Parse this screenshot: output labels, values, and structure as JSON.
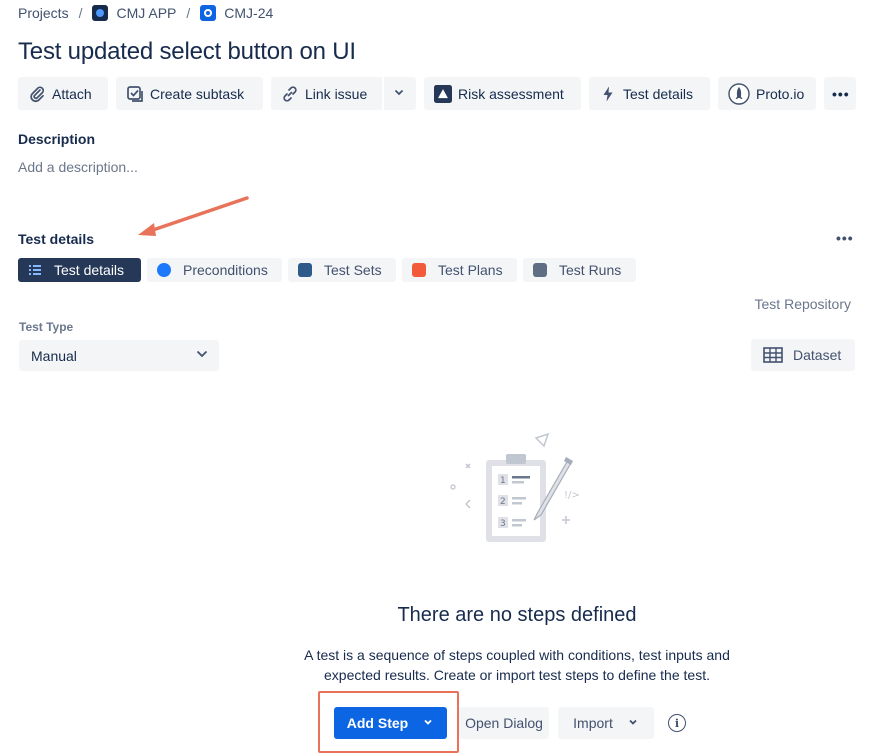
{
  "breadcrumb": {
    "projects": "Projects",
    "app": "CMJ APP",
    "issue": "CMJ-24",
    "separator": "/"
  },
  "issue": {
    "title": "Test updated select button on UI"
  },
  "toolbar": {
    "attach": "Attach",
    "create_subtask": "Create subtask",
    "link_issue": "Link issue",
    "risk_assessment": "Risk assessment",
    "test_details": "Test details",
    "proto": "Proto.io",
    "more": "•••"
  },
  "description": {
    "heading": "Description",
    "placeholder": "Add a description..."
  },
  "test_panel": {
    "heading": "Test details",
    "more": "•••",
    "tabs": [
      {
        "label": "Test details",
        "active": true,
        "icon": "list-icon"
      },
      {
        "label": "Preconditions",
        "active": false,
        "icon": "preconditions-icon"
      },
      {
        "label": "Test Sets",
        "active": false,
        "icon": "test-sets-icon"
      },
      {
        "label": "Test Plans",
        "active": false,
        "icon": "test-plans-icon"
      },
      {
        "label": "Test Runs",
        "active": false,
        "icon": "test-runs-icon"
      }
    ],
    "repository_link": "Test Repository",
    "test_type_label": "Test Type",
    "test_type_value": "Manual",
    "dataset": "Dataset"
  },
  "empty_state": {
    "title": "There are no steps defined",
    "description": "A test is a sequence of steps coupled with conditions, test inputs and expected results. Create or import test steps to define the test.",
    "add_step": "Add Step",
    "open_dialog": "Open Dialog",
    "import": "Import",
    "info": "i"
  },
  "colors": {
    "primary": "#0c66e4",
    "active_tab": "#253858",
    "annotation": "#e8735a"
  }
}
